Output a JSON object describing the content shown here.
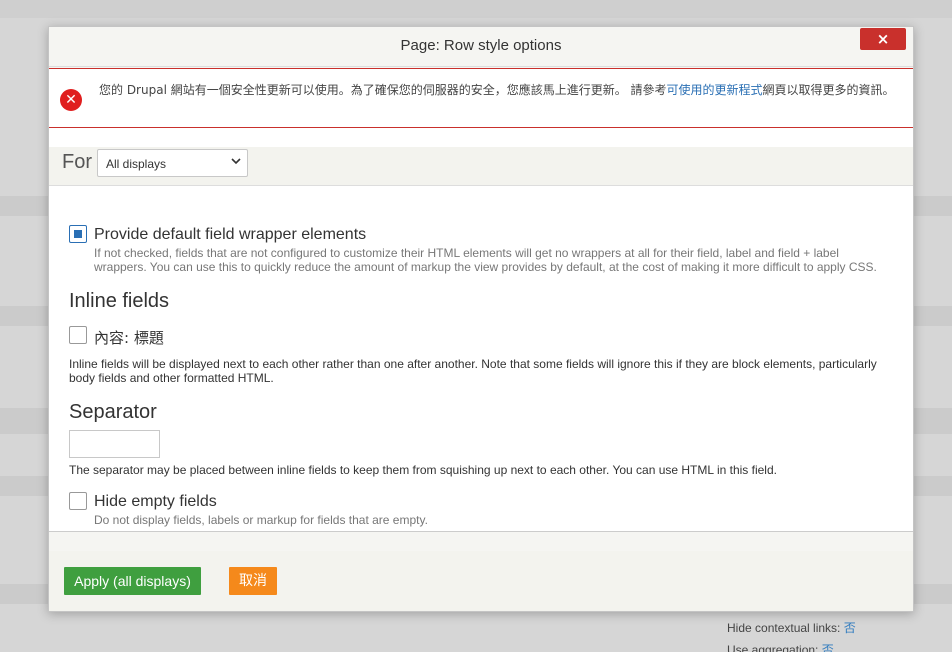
{
  "dialog": {
    "title": "Page: Row style options",
    "close_label": "×"
  },
  "error": {
    "text_before": "您的 Drupal 網站有一個安全性更新可以使用。為了確保您的伺服器的安全，您應該馬上進行更新。 請參考",
    "link_text": "可使用的更新程式",
    "text_after": "網頁以取得更多的資訊。"
  },
  "for_bar": {
    "label": "For",
    "selected": "All displays"
  },
  "options": {
    "default_wrapper": {
      "label": "Provide default field wrapper elements",
      "checked": true,
      "description": "If not checked, fields that are not configured to customize their HTML elements will get no wrappers at all for their field, label and field + label wrappers. You can use this to quickly reduce the amount of markup the view provides by default, at the cost of making it more difficult to apply CSS."
    },
    "inline_fields": {
      "heading": "Inline fields",
      "item_label": "內容: 標題",
      "checked": false,
      "description": "Inline fields will be displayed next to each other rather than one after another. Note that some fields will ignore this if they are block elements, particularly body fields and other formatted HTML."
    },
    "separator": {
      "heading": "Separator",
      "value": "",
      "description": "The separator may be placed between inline fields to keep them from squishing up next to each other. You can use HTML in this field."
    },
    "hide_empty": {
      "label": "Hide empty fields",
      "checked": false,
      "description": "Do not display fields, labels or markup for fields that are empty."
    }
  },
  "buttons": {
    "apply": "Apply (all displays)",
    "cancel": "取消"
  },
  "background": {
    "hide_contextual_label": "Hide contextual links:",
    "hide_contextual_value": "否",
    "use_aggregation_label": "Use aggregation:",
    "use_aggregation_value": "否"
  },
  "colors": {
    "accent": "#2a6fb4",
    "error": "#c9302c",
    "apply": "#3f9f3f",
    "cancel": "#f5891b"
  }
}
